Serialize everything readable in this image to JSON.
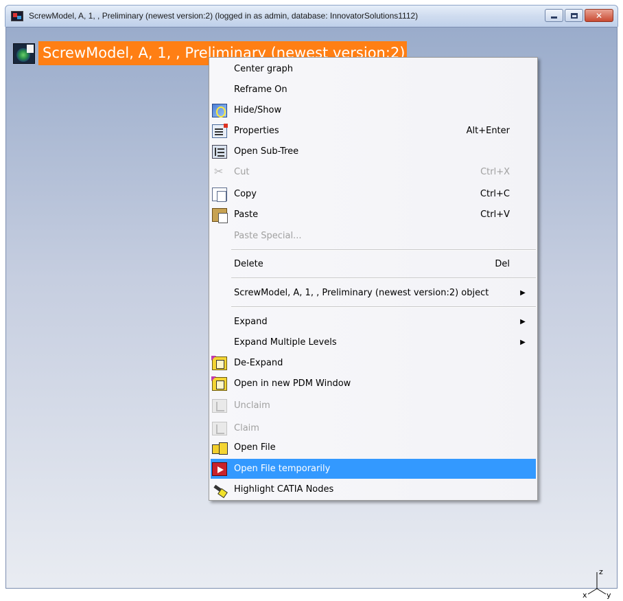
{
  "window": {
    "title": "ScrewModel, A, 1, , Preliminary (newest version:2) (logged in as admin, database: InnovatorSolutions1112)",
    "controls": {
      "minimize_icon": "minimize-icon",
      "maximize_icon": "maximize-icon",
      "close_icon": "close-icon",
      "close_glyph": "✕"
    }
  },
  "tree": {
    "node_label": "ScrewModel, A, 1, , Preliminary (newest version:2)",
    "node_icon": "product-node-icon",
    "highlight_color": "#ff7f14"
  },
  "axis": {
    "z_label": "z",
    "x_label": "x",
    "y_label": "y"
  },
  "context_menu": {
    "items": [
      {
        "label": "Center graph",
        "shortcut": "",
        "icon": "",
        "disabled": false
      },
      {
        "label": "Reframe On",
        "shortcut": "",
        "icon": "",
        "disabled": false
      },
      {
        "label": "Hide/Show",
        "shortcut": "",
        "icon": "hide-show-icon",
        "disabled": false
      },
      {
        "label": "Properties",
        "shortcut": "Alt+Enter",
        "icon": "properties-icon",
        "disabled": false
      },
      {
        "label": "Open Sub-Tree",
        "shortcut": "",
        "icon": "sub-tree-icon",
        "disabled": false
      },
      {
        "label": "Cut",
        "shortcut": "Ctrl+X",
        "icon": "cut-icon",
        "disabled": true
      },
      {
        "label": "Copy",
        "shortcut": "Ctrl+C",
        "icon": "copy-icon",
        "disabled": false
      },
      {
        "label": "Paste",
        "shortcut": "Ctrl+V",
        "icon": "paste-icon",
        "disabled": false
      },
      {
        "label": "Paste Special...",
        "shortcut": "",
        "icon": "",
        "disabled": true
      },
      {
        "label": "Delete",
        "shortcut": "Del",
        "icon": "",
        "disabled": false
      },
      {
        "label": "ScrewModel, A, 1, , Preliminary (newest version:2) object",
        "shortcut": "",
        "icon": "",
        "disabled": false,
        "submenu": true
      },
      {
        "label": "Expand",
        "shortcut": "",
        "icon": "",
        "disabled": false,
        "submenu": true
      },
      {
        "label": "Expand Multiple Levels",
        "shortcut": "",
        "icon": "",
        "disabled": false,
        "submenu": true
      },
      {
        "label": "De-Expand",
        "shortcut": "",
        "icon": "de-expand-icon",
        "disabled": false
      },
      {
        "label": "Open in new PDM Window",
        "shortcut": "",
        "icon": "pdm-window-icon",
        "disabled": false
      },
      {
        "label": "Unclaim",
        "shortcut": "",
        "icon": "unclaim-icon",
        "disabled": true
      },
      {
        "label": "Claim",
        "shortcut": "",
        "icon": "claim-icon",
        "disabled": true
      },
      {
        "label": "Open File",
        "shortcut": "",
        "icon": "open-file-icon",
        "disabled": false
      },
      {
        "label": "Open File temporarily",
        "shortcut": "",
        "icon": "open-file-temporarily-icon",
        "disabled": false,
        "highlighted": true
      },
      {
        "label": "Highlight CATIA Nodes",
        "shortcut": "",
        "icon": "highlight-nodes-icon",
        "disabled": false
      }
    ],
    "submenu_arrow": "▶",
    "highlight_color": "#3399ff"
  }
}
